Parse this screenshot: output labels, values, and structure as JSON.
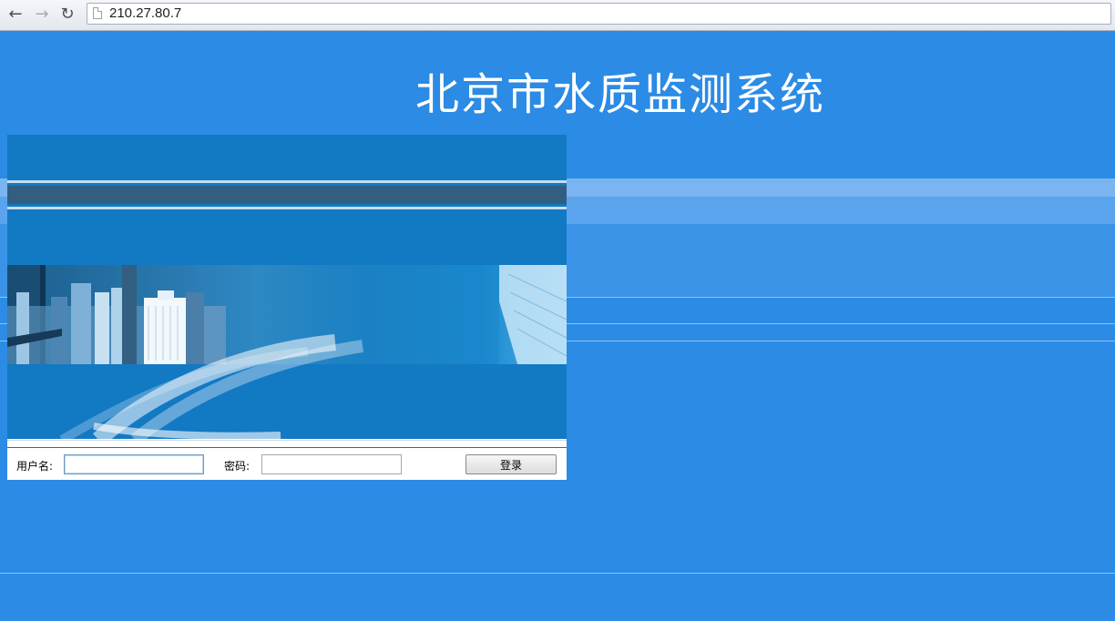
{
  "browser": {
    "back_glyph": "←",
    "forward_glyph": "→",
    "reload_glyph": "↻",
    "url": "210.27.80.7"
  },
  "page": {
    "title": "北京市水质监测系统"
  },
  "login": {
    "username_label": "用户名:",
    "username_value": "",
    "password_label": "密码:",
    "password_value": "",
    "submit_label": "登录"
  },
  "colors": {
    "page_background": "#2b8be5",
    "banner_background": "#1279c3",
    "title_text": "#ffffff"
  },
  "icons": {
    "back": "arrow-left-icon",
    "forward": "arrow-right-icon",
    "reload": "reload-icon",
    "page": "page-icon"
  }
}
